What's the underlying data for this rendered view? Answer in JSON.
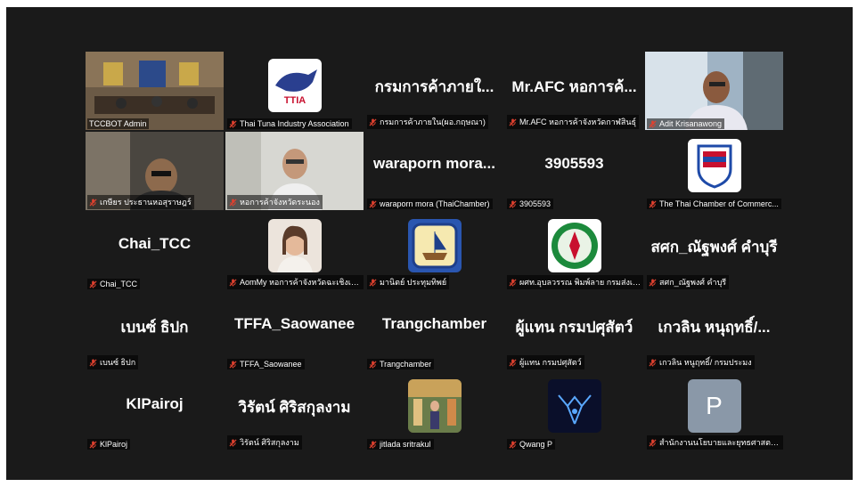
{
  "colors": {
    "background": "#1a1a1a",
    "active_border": "#27c24a",
    "muted_mic": "#e0412f"
  },
  "mic_icon": "muted-microphone-icon",
  "participants": [
    {
      "label": "TCCBOT Admin",
      "view": "video",
      "active": true
    },
    {
      "label": "Thai Tuna Industry Association",
      "view": "logo"
    },
    {
      "label": "กรมการค้าภายใน(ผอ.กฤษณา)",
      "display": "กรมการค้าภายใ...",
      "view": "name"
    },
    {
      "label": "Mr.AFC หอการค้าจังหวัดกาฬสินธุ์",
      "display": "Mr.AFC หอการค้...",
      "view": "name"
    },
    {
      "label": "Adit Krisanawong",
      "view": "video"
    },
    {
      "label": "เกษียร ประธานหอสุราษฎร์",
      "view": "video"
    },
    {
      "label": "หอการค้าจังหวัดระนอง",
      "view": "video"
    },
    {
      "label": "waraporn mora (ThaiChamber)",
      "display": "waraporn  mora...",
      "view": "name"
    },
    {
      "label": "3905593",
      "display": "3905593",
      "view": "name"
    },
    {
      "label": "The Thai Chamber of Commerc...",
      "view": "logo"
    },
    {
      "label": "Chai_TCC",
      "display": "Chai_TCC",
      "view": "name"
    },
    {
      "label": "AomMy หอการค้าจังหวัดฉะเชิงเทรา",
      "view": "photo"
    },
    {
      "label": "มานิตย์ ประทุมทิพย์",
      "view": "logo"
    },
    {
      "label": "ผศท.อุบลวรรณ พิมพ์ลาย กรมส่งเสริ...",
      "view": "logo"
    },
    {
      "label": "สศก_ณัฐพงศ์ คำบุรี",
      "display": "สศก_ณัฐพงศ์ คำบุรี",
      "view": "name"
    },
    {
      "label": "เบนซ์ ธิปก",
      "display": "เบนซ์ ธิปก",
      "view": "name"
    },
    {
      "label": "TFFA_Saowanee",
      "display": "TFFA_Saowanee",
      "view": "name"
    },
    {
      "label": "Trangchamber",
      "display": "Trangchamber",
      "view": "name"
    },
    {
      "label": "ผู้แทน กรมปศุสัตว์",
      "display": "ผู้แทน กรมปศุสัตว์",
      "view": "name"
    },
    {
      "label": "เกวลิน หนูฤทธิ์/ กรมประมง",
      "display": "เกวลิน หนุฤทธิ์/...",
      "view": "name"
    },
    {
      "label": "KlPairoj",
      "display": "KlPairoj",
      "view": "name"
    },
    {
      "label": "วิรัตน์ ศิริสกุลงาม",
      "display": "วิรัตน์ ศิริสกุลงาม",
      "view": "name"
    },
    {
      "label": "jitlada sritrakul",
      "view": "photo"
    },
    {
      "label": "Qwang P",
      "view": "photo"
    },
    {
      "label": "สำนักงานนโยบายและยุทธศาสตร์การ...",
      "initial": "P",
      "view": "initial"
    }
  ]
}
